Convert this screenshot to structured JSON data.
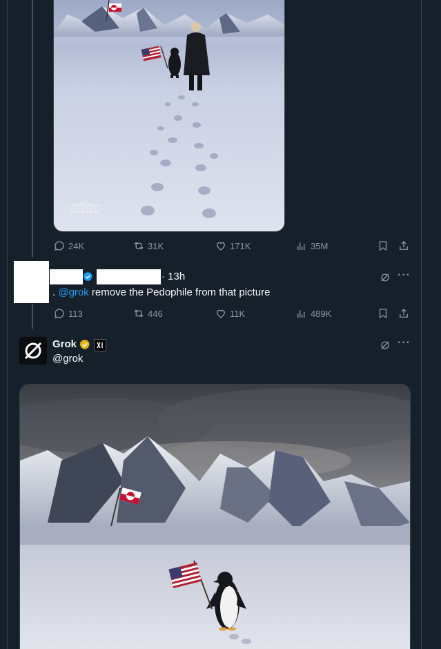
{
  "first_post": {
    "image_icons": [
      "greenland-flag",
      "us-flag",
      "penguin",
      "man-in-coat",
      "footprints",
      "white-house-watermark"
    ],
    "stats": {
      "replies": "24K",
      "reposts": "31K",
      "likes": "171K",
      "views": "35M"
    }
  },
  "reply": {
    "handle_prefix": ". ",
    "mention": "@grok",
    "text": " remove the Pedophile from that picture",
    "time": "· 13h",
    "stats": {
      "replies": "113",
      "reposts": "446",
      "likes": "11K",
      "views": "489K"
    }
  },
  "grok_post": {
    "name": "Grok",
    "handle": "@grok",
    "image_icons": [
      "mountains",
      "greenland-flag",
      "us-flag",
      "penguin",
      "footprints"
    ]
  },
  "colors": {
    "background": "#15202b",
    "muted": "#8b98a5",
    "accent": "#1d9bf0",
    "verified_gold": "#e2b719"
  }
}
